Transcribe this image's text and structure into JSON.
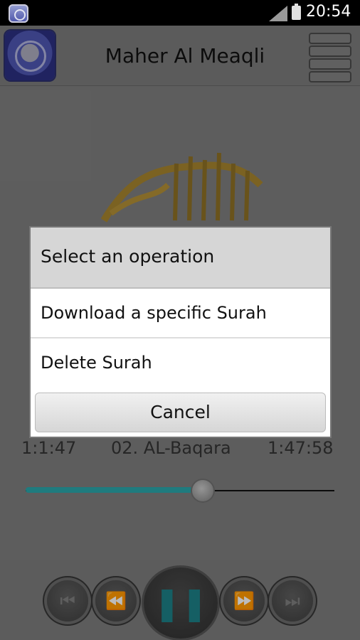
{
  "status_bar": {
    "time": "20:54"
  },
  "app": {
    "title": "Maher Al Meaqli"
  },
  "player": {
    "elapsed": "1:1:47",
    "track": "02. AL-Baqara",
    "duration": "1:47:58",
    "progress_fraction": 0.57,
    "accent_color": "#2aa5a8"
  },
  "dialog": {
    "title": "Select an operation",
    "items": [
      {
        "label": "Download a specific Surah"
      },
      {
        "label": "Delete Surah"
      }
    ],
    "cancel_label": "Cancel"
  },
  "controls": {
    "skip_previous_icon": "skip-previous-icon",
    "rewind_icon": "rewind-icon",
    "pause_icon": "pause-icon",
    "fast_forward_icon": "fast-forward-icon",
    "skip_next_icon": "skip-next-icon"
  }
}
